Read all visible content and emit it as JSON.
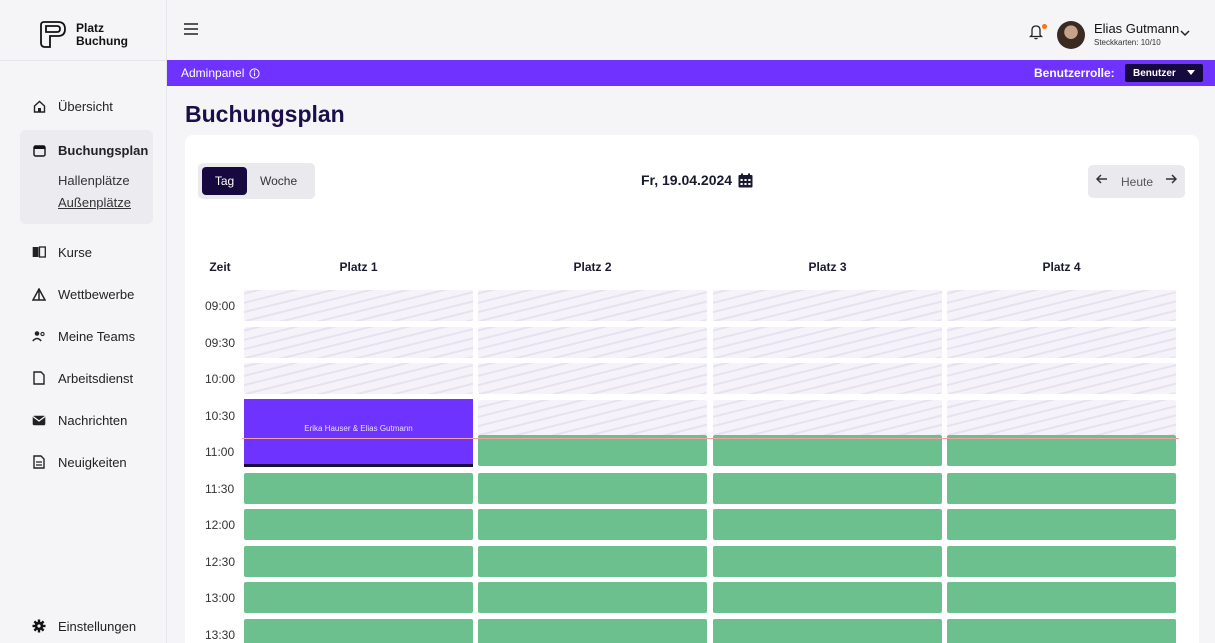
{
  "app": {
    "name_line1": "Platz",
    "name_line2": "Buchung"
  },
  "sidebar": {
    "items": [
      {
        "label": "Übersicht",
        "icon": "home-icon"
      },
      {
        "label": "Buchungsplan",
        "icon": "calendar-icon",
        "active": true,
        "subitems": [
          {
            "label": "Hallenplätze"
          },
          {
            "label": "Außenplätze",
            "selected": true
          }
        ]
      },
      {
        "label": "Kurse",
        "icon": "book-icon"
      },
      {
        "label": "Wettbewerbe",
        "icon": "trophy-icon"
      },
      {
        "label": "Meine Teams",
        "icon": "team-icon"
      },
      {
        "label": "Arbeitsdienst",
        "icon": "document-icon"
      },
      {
        "label": "Nachrichten",
        "icon": "mail-icon"
      },
      {
        "label": "Neuigkeiten",
        "icon": "news-icon"
      }
    ],
    "settings_label": "Einstellungen"
  },
  "header": {
    "user_name": "Elias Gutmann",
    "user_status": "Steckkarten: 10/10"
  },
  "adminbar": {
    "label": "Adminpanel",
    "role_label": "Benutzerrolle:",
    "role_value": "Benutzer"
  },
  "page": {
    "title": "Buchungsplan"
  },
  "view_toggle": {
    "day": "Tag",
    "week": "Woche",
    "active": "day"
  },
  "date_label": "Fr, 19.04.2024",
  "today_nav": {
    "label": "Heute"
  },
  "schedule": {
    "time_header": "Zeit",
    "courts": [
      "Platz 1",
      "Platz 2",
      "Platz 3",
      "Platz 4"
    ],
    "times": [
      "09:00",
      "09:30",
      "10:00",
      "10:30",
      "11:00",
      "11:30",
      "12:00",
      "12:30",
      "13:00",
      "13:30"
    ],
    "booking": {
      "label": "Erika Hauser & Elias Gutmann",
      "court": "Platz 1",
      "start": "10:30",
      "end": "11:30"
    }
  },
  "colors": {
    "accent": "#6e33ff",
    "dark": "#17093f",
    "free": "#6cc08e",
    "now_line": "#f3a2a2",
    "notification_dot": "#f97316"
  }
}
